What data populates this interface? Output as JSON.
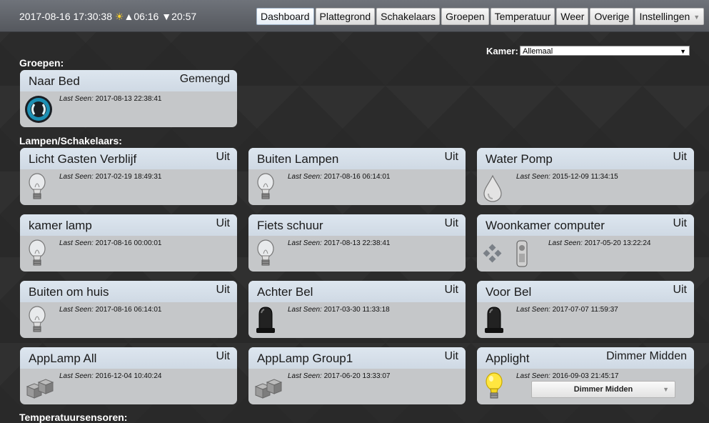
{
  "header": {
    "datetime": "2017-08-16 17:30:38",
    "sunrise": "06:16",
    "sunset": "20:57"
  },
  "nav": [
    {
      "label": "Dashboard",
      "active": true
    },
    {
      "label": "Plattegrond"
    },
    {
      "label": "Schakelaars"
    },
    {
      "label": "Groepen"
    },
    {
      "label": "Temperatuur"
    },
    {
      "label": "Weer"
    },
    {
      "label": "Overige"
    },
    {
      "label": "Instellingen"
    }
  ],
  "room": {
    "label": "Kamer:",
    "value": "Allemaal"
  },
  "sections": {
    "groups": "Groepen:",
    "lights": "Lampen/Schakelaars:",
    "temp": "Temperatuursensoren:"
  },
  "last_seen_label": "Last Seen:",
  "groups": [
    {
      "name": "Naar Bed",
      "status": "Gemengd",
      "last_seen": "2017-08-13 22:38:41",
      "icon": "group-icon"
    }
  ],
  "devices": [
    {
      "name": "Licht Gasten Verblijf",
      "status": "Uit",
      "last_seen": "2017-02-19 18:49:31",
      "icon": "bulb-icon"
    },
    {
      "name": "Buiten Lampen",
      "status": "Uit",
      "last_seen": "2017-08-16 06:14:01",
      "icon": "bulb-icon"
    },
    {
      "name": "Water Pomp",
      "status": "Uit",
      "last_seen": "2015-12-09 11:34:15",
      "icon": "water-drop-icon"
    },
    {
      "name": "kamer lamp",
      "status": "Uit",
      "last_seen": "2017-08-16 00:00:01",
      "icon": "bulb-icon"
    },
    {
      "name": "Fiets schuur",
      "status": "Uit",
      "last_seen": "2017-08-13 22:38:41",
      "icon": "bulb-icon"
    },
    {
      "name": "Woonkamer computer",
      "status": "Uit",
      "last_seen": "2017-05-20 13:22:24",
      "icon": "kodi-remote-icon"
    },
    {
      "name": "Buiten om huis",
      "status": "Uit",
      "last_seen": "2017-08-16 06:14:01",
      "icon": "bulb-icon"
    },
    {
      "name": "Achter Bel",
      "status": "Uit",
      "last_seen": "2017-03-30 11:33:18",
      "icon": "siren-icon"
    },
    {
      "name": "Voor Bel",
      "status": "Uit",
      "last_seen": "2017-07-07 11:59:37",
      "icon": "siren-icon"
    },
    {
      "name": "AppLamp All",
      "status": "Uit",
      "last_seen": "2016-12-04 10:40:24",
      "icon": "cubes-icon"
    },
    {
      "name": "AppLamp Group1",
      "status": "Uit",
      "last_seen": "2017-06-20 13:33:07",
      "icon": "cubes-icon"
    },
    {
      "name": "Applight",
      "status": "Dimmer Midden",
      "last_seen": "2016-09-03 21:45:17",
      "icon": "bulb-on-icon",
      "select": "Dimmer Midden"
    }
  ],
  "colors": {
    "card_bg": "#c5c7c9",
    "card_header": "#d7e1eb",
    "sun": "#ffd22a"
  }
}
